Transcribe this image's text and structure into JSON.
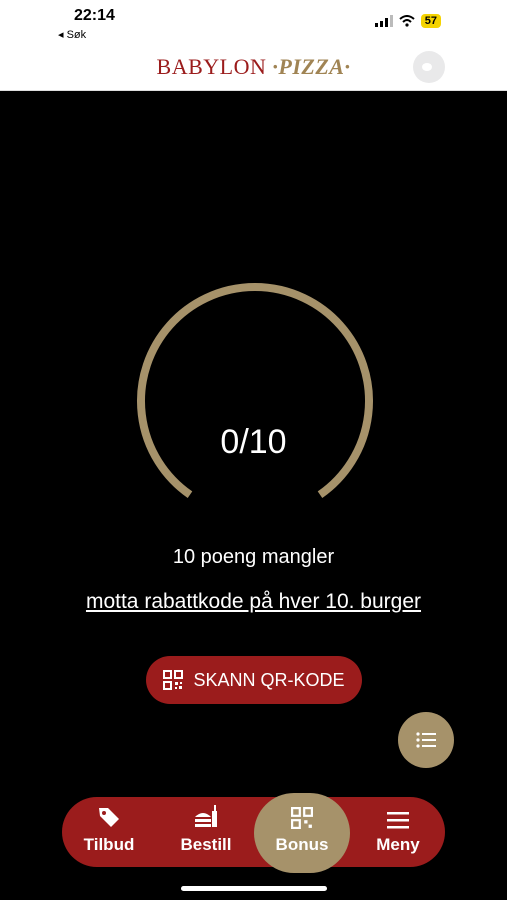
{
  "status": {
    "time": "22:14",
    "back_label": "◂ Søk",
    "battery": "57"
  },
  "header": {
    "brand_left": "BABYLON",
    "brand_right": "PIZZA"
  },
  "loyalty": {
    "progress_text": "0/10",
    "progress_fraction": 0,
    "points_missing": "10 poeng mangler",
    "reward_text": "motta rabattkode på hver 10. burger",
    "scan_label": "SKANN QR-KODE"
  },
  "tabs": [
    {
      "label": "Tilbud",
      "icon": "tag-icon"
    },
    {
      "label": "Bestill",
      "icon": "burger-drink-icon"
    },
    {
      "label": "Bonus",
      "icon": "qr-icon",
      "active": true
    },
    {
      "label": "Meny",
      "icon": "menu-icon"
    }
  ],
  "colors": {
    "brand_red": "#9b1c1c",
    "gold": "#a6926a"
  }
}
